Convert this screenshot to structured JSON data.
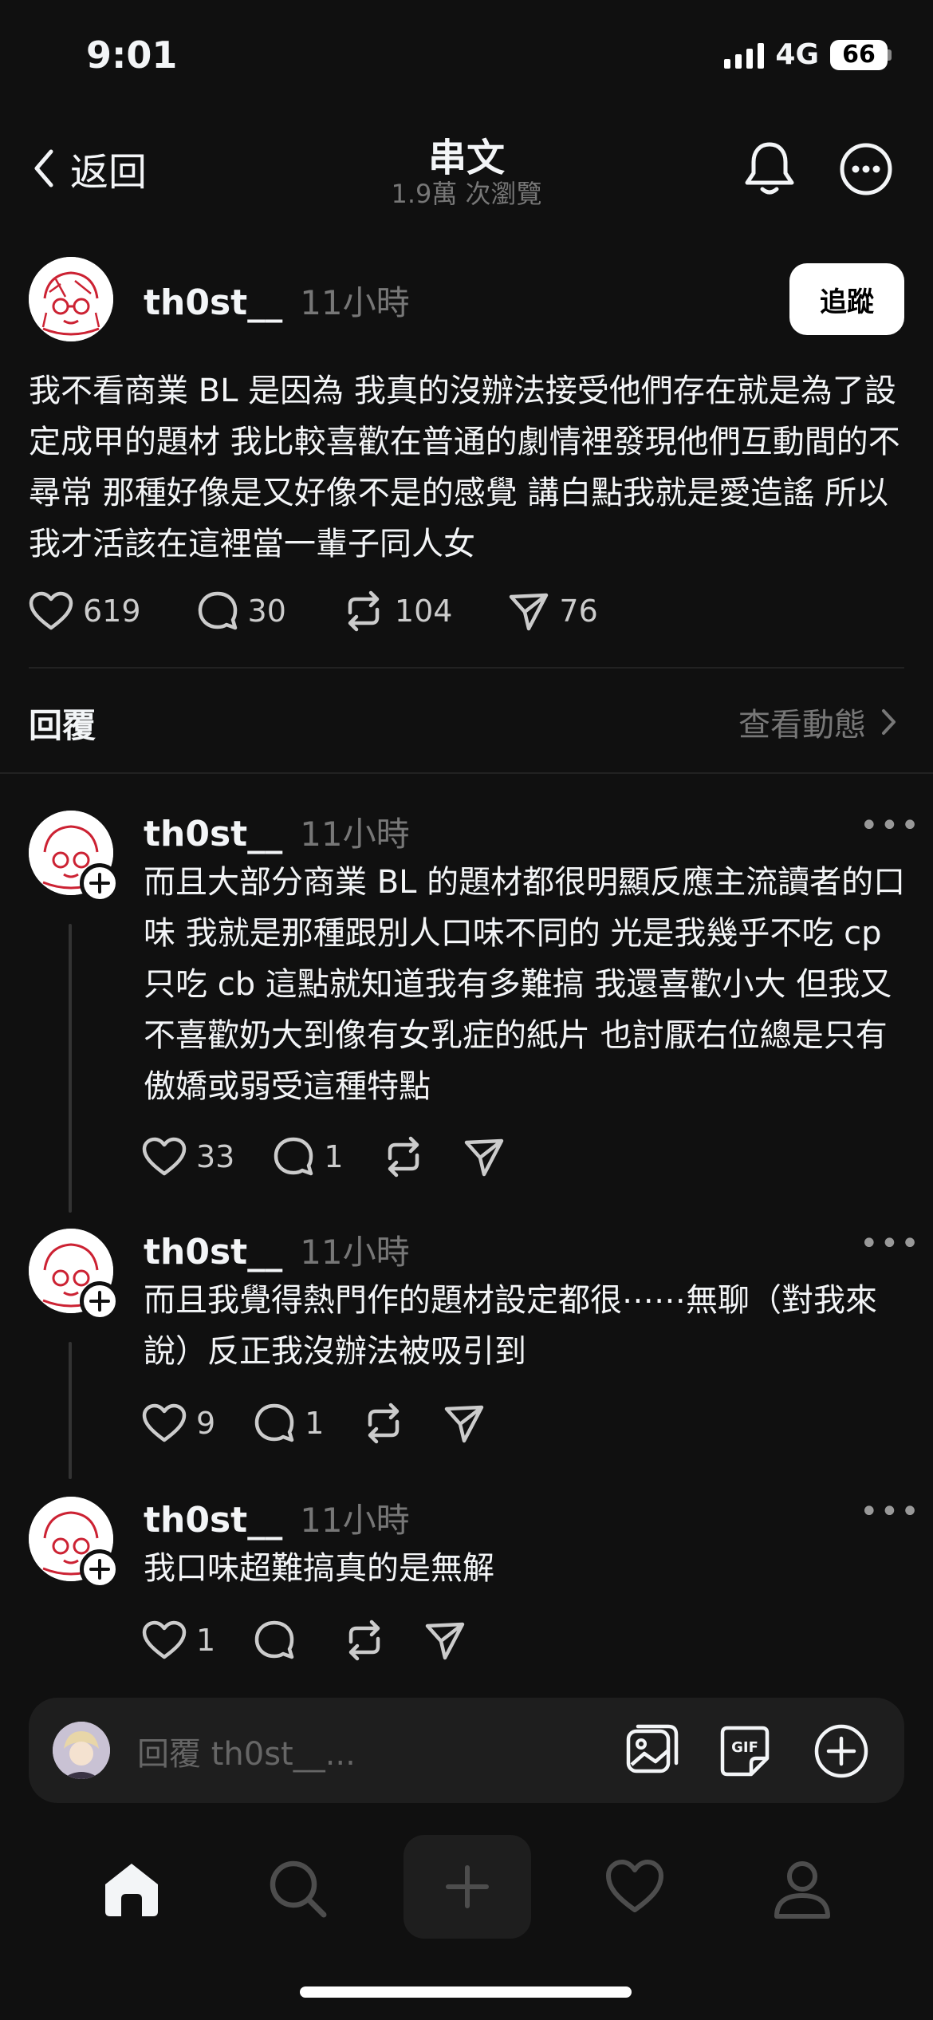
{
  "status_bar": {
    "time": "9:01",
    "network": "4G",
    "battery": "66"
  },
  "header": {
    "back_label": "返回",
    "title": "串文",
    "views": "1.9萬 次瀏覽"
  },
  "post": {
    "username": "th0st__",
    "time": "11小時",
    "follow_label": "追蹤",
    "text": "我不看商業 BL 是因為 我真的沒辦法接受他們存在就是為了設定成甲的題材 我比較喜歡在普通的劇情裡發現他們互動間的不尋常 那種好像是又好像不是的感覺 講白點我就是愛造謠 所以我才活該在這裡當一輩子同人女",
    "likes": "619",
    "comments": "30",
    "reposts": "104",
    "shares": "76"
  },
  "replies_section": {
    "label": "回覆",
    "activity_link": "查看動態"
  },
  "replies": [
    {
      "username": "th0st__",
      "time": "11小時",
      "text": "而且大部分商業 BL 的題材都很明顯反應主流讀者的口味 我就是那種跟別人口味不同的 光是我幾乎不吃 cp 只吃 cb 這點就知道我有多難搞 我還喜歡小大 但我又不喜歡奶大到像有女乳症的紙片 也討厭右位總是只有傲嬌或弱受這種特點",
      "likes": "33",
      "comments": "1"
    },
    {
      "username": "th0st__",
      "time": "11小時",
      "text": "而且我覺得熱門作的題材設定都很⋯⋯無聊（對我來說）反正我沒辦法被吸引到",
      "likes": "9",
      "comments": "1"
    },
    {
      "username": "th0st__",
      "time": "11小時",
      "text": "我口味超難搞真的是無解",
      "likes": "1",
      "comments": ""
    }
  ],
  "composer": {
    "placeholder": "回覆 th0st__..."
  },
  "colors": {
    "background": "#101010",
    "text": "#f3f5f7",
    "muted": "#777777",
    "surface": "#1e1e1e"
  }
}
